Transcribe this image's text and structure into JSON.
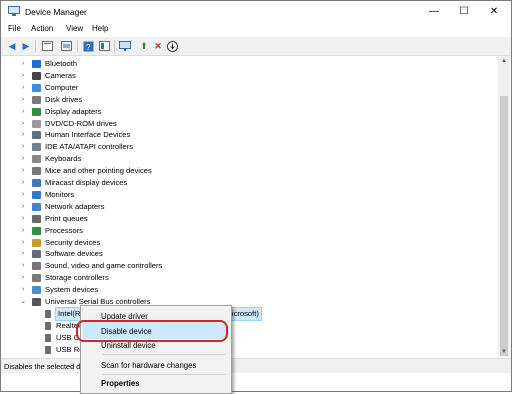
{
  "window": {
    "title": "Device Manager",
    "controls": [
      "—",
      "☐",
      "✕"
    ]
  },
  "menubar": {
    "items": [
      "File",
      "Action",
      "View",
      "Help"
    ]
  },
  "toolbar": {
    "buttons": [
      "back-arrow",
      "forward-arrow",
      "properties",
      "show-hidden",
      "help",
      "scan",
      "monitor",
      "update-driver",
      "uninstall",
      "download"
    ]
  },
  "tree": {
    "items": [
      {
        "label": "Bluetooth",
        "color": "#1f6fd1",
        "expanded": false
      },
      {
        "label": "Cameras",
        "color": "#444444",
        "expanded": false
      },
      {
        "label": "Computer",
        "color": "#3a8fd8",
        "expanded": false
      },
      {
        "label": "Disk drives",
        "color": "#7a7a7a",
        "expanded": false
      },
      {
        "label": "Display adapters",
        "color": "#2f8f3f",
        "expanded": false
      },
      {
        "label": "DVD/CD-ROM drives",
        "color": "#9a9a9a",
        "expanded": false
      },
      {
        "label": "Human Interface Devices",
        "color": "#5c6f87",
        "expanded": false
      },
      {
        "label": "IDE ATA/ATAPI controllers",
        "color": "#6d7f97",
        "expanded": false
      },
      {
        "label": "Keyboards",
        "color": "#888888",
        "expanded": false
      },
      {
        "label": "Mice and other pointing devices",
        "color": "#777777",
        "expanded": false
      },
      {
        "label": "Miracast display devices",
        "color": "#3a78c2",
        "expanded": false
      },
      {
        "label": "Monitors",
        "color": "#2d7dcf",
        "expanded": false
      },
      {
        "label": "Network adapters",
        "color": "#3c86d0",
        "expanded": false
      },
      {
        "label": "Print queues",
        "color": "#6a6a6a",
        "expanded": false
      },
      {
        "label": "Processors",
        "color": "#2f8f3f",
        "expanded": false
      },
      {
        "label": "Security devices",
        "color": "#c69c2e",
        "expanded": false
      },
      {
        "label": "Software devices",
        "color": "#5d6d82",
        "expanded": false
      },
      {
        "label": "Sound, video and game controllers",
        "color": "#777777",
        "expanded": false
      },
      {
        "label": "Storage controllers",
        "color": "#7a7a7a",
        "expanded": false
      },
      {
        "label": "System devices",
        "color": "#4d8dc8",
        "expanded": false
      },
      {
        "label": "Universal Serial Bus controllers",
        "color": "#555555",
        "expanded": true
      }
    ],
    "children": [
      {
        "label": "Intel(R) USB 3.0 eXtensible Host Controller - 1.0 (Microsoft)",
        "selected": true
      },
      {
        "label": "Realtek",
        "selected": false
      },
      {
        "label": "USB C",
        "selected": false
      },
      {
        "label": "USB Ro",
        "selected": false
      }
    ]
  },
  "statusbar": {
    "text": "Disables the selected d"
  },
  "context_menu": {
    "items": [
      "Update driver",
      "Disable device",
      "Uninstall device",
      "Scan for hardware changes",
      "Properties"
    ],
    "highlighted": "Disable device"
  }
}
